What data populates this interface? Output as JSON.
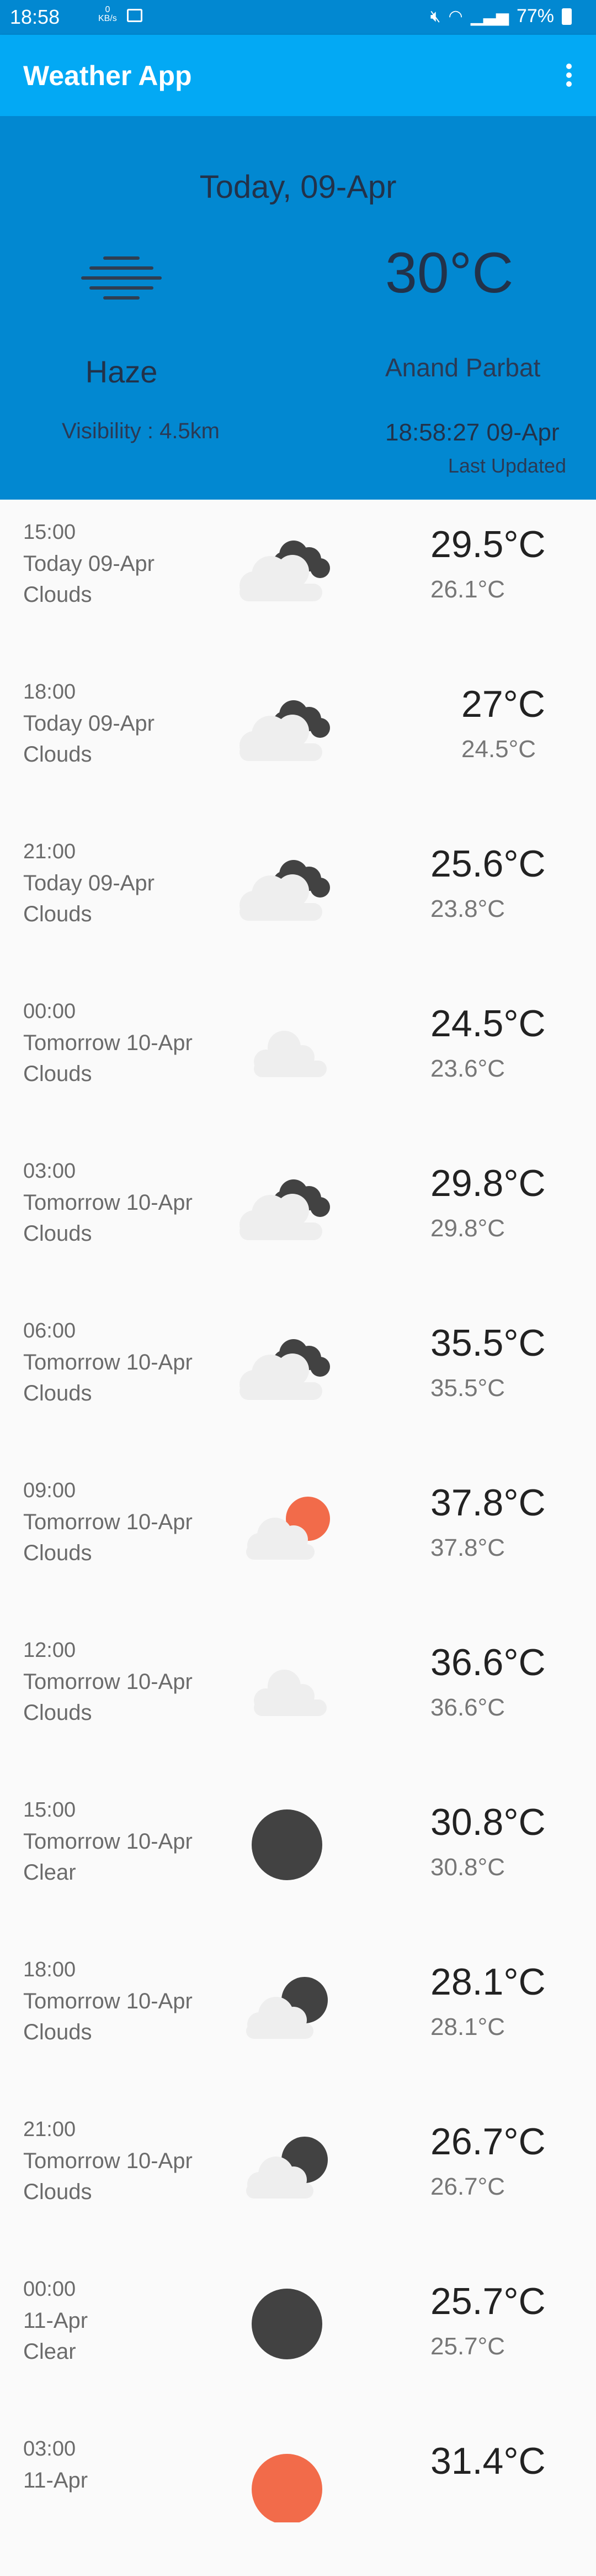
{
  "status_bar": {
    "time": "18:58",
    "net_speed": "0 KB/s",
    "battery": "77%",
    "icons": [
      "gallery-icon",
      "mute-icon",
      "volte-icon",
      "wifi-icon",
      "signal-icon",
      "battery-icon"
    ]
  },
  "app_bar": {
    "title": "Weather App",
    "menu_icon": "more-vert-icon"
  },
  "current": {
    "date": "Today, 09-Apr",
    "temperature": "30°C",
    "condition": "Haze",
    "condition_icon": "haze-icon",
    "city": "Anand Parbat",
    "visibility": "Visibility : 4.5km",
    "updated_time": "18:58:27 09-Apr",
    "updated_label": "Last Updated"
  },
  "colors": {
    "status_bar": "#0288d1",
    "app_bar": "#03a9f4",
    "hero": "#0288d1",
    "list_bg": "#fafafa",
    "cloud_dark": "#424242",
    "cloud_light": "#eeeeee",
    "sun": "#f26b4a"
  },
  "forecast": [
    {
      "time": "15:00",
      "day": "Today 09-Apr",
      "desc": "Clouds",
      "icon": "cloud-night-icon",
      "tmax": "29.5°C",
      "tmin": "26.1°C"
    },
    {
      "time": "18:00",
      "day": "Today 09-Apr",
      "desc": "Clouds",
      "icon": "cloud-night-icon",
      "tmax": "27°C",
      "tmin": "24.5°C"
    },
    {
      "time": "21:00",
      "day": "Today 09-Apr",
      "desc": "Clouds",
      "icon": "cloud-night-icon",
      "tmax": "25.6°C",
      "tmin": "23.8°C"
    },
    {
      "time": "00:00",
      "day": "Tomorrow 10-Apr",
      "desc": "Clouds",
      "icon": "light-cloud-icon",
      "tmax": "24.5°C",
      "tmin": "23.6°C"
    },
    {
      "time": "03:00",
      "day": "Tomorrow 10-Apr",
      "desc": "Clouds",
      "icon": "cloud-night-icon",
      "tmax": "29.8°C",
      "tmin": "29.8°C"
    },
    {
      "time": "06:00",
      "day": "Tomorrow 10-Apr",
      "desc": "Clouds",
      "icon": "cloud-night-icon",
      "tmax": "35.5°C",
      "tmin": "35.5°C"
    },
    {
      "time": "09:00",
      "day": "Tomorrow 10-Apr",
      "desc": "Clouds",
      "icon": "sun-cloud-icon",
      "tmax": "37.8°C",
      "tmin": "37.8°C"
    },
    {
      "time": "12:00",
      "day": "Tomorrow 10-Apr",
      "desc": "Clouds",
      "icon": "light-cloud-icon",
      "tmax": "36.6°C",
      "tmin": "36.6°C"
    },
    {
      "time": "15:00",
      "day": "Tomorrow 10-Apr",
      "desc": "Clear",
      "icon": "dark-circle-icon",
      "tmax": "30.8°C",
      "tmin": "30.8°C"
    },
    {
      "time": "18:00",
      "day": "Tomorrow 10-Apr",
      "desc": "Clouds",
      "icon": "moon-cloud-icon",
      "tmax": "28.1°C",
      "tmin": "28.1°C"
    },
    {
      "time": "21:00",
      "day": "Tomorrow 10-Apr",
      "desc": "Clouds",
      "icon": "moon-cloud-icon",
      "tmax": "26.7°C",
      "tmin": "26.7°C"
    },
    {
      "time": "00:00",
      "day": "11-Apr",
      "desc": "Clear",
      "icon": "dark-circle-icon",
      "tmax": "25.7°C",
      "tmin": "25.7°C"
    },
    {
      "time": "03:00",
      "day": "11-Apr",
      "desc": "",
      "icon": "sun-icon",
      "tmax": "31.4°C",
      "tmin": ""
    }
  ]
}
